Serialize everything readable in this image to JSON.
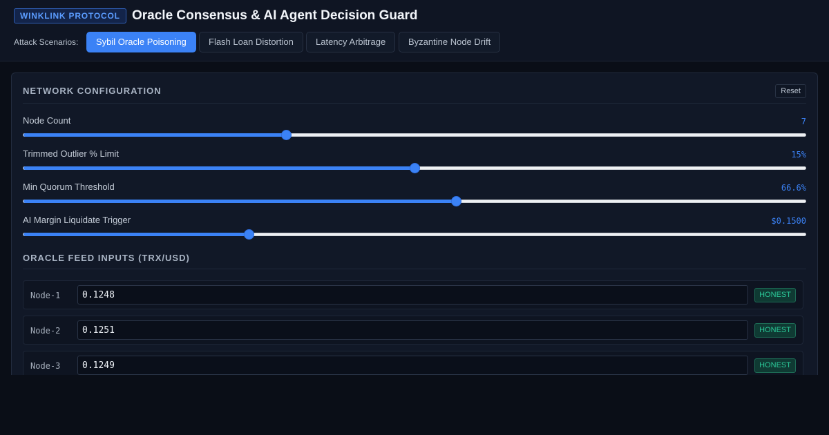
{
  "header": {
    "brand": "WINKLINK PROTOCOL",
    "title": "Oracle Consensus & AI Agent Decision Guard",
    "scenarios_label": "Attack Scenarios:",
    "scenarios": [
      {
        "label": "Sybil Oracle Poisoning",
        "active": true
      },
      {
        "label": "Flash Loan Distortion",
        "active": false
      },
      {
        "label": "Latency Arbitrage",
        "active": false
      },
      {
        "label": "Byzantine Node Drift",
        "active": false
      }
    ]
  },
  "network_config": {
    "title": "NETWORK CONFIGURATION",
    "reset_label": "Reset",
    "sliders": [
      {
        "label": "Node Count",
        "value": "7",
        "fill_fraction": 0.336
      },
      {
        "label": "Trimmed Outlier % Limit",
        "value": "15%",
        "fill_fraction": 0.5
      },
      {
        "label": "Min Quorum Threshold",
        "value": "66.6%",
        "fill_fraction": 0.553
      },
      {
        "label": "AI Margin Liquidate Trigger",
        "value": "$0.1500",
        "fill_fraction": 0.288
      }
    ]
  },
  "oracle_feed": {
    "title": "ORACLE FEED INPUTS (TRX/USD)",
    "nodes": [
      {
        "label": "Node-1",
        "value": "0.1248",
        "status": "HONEST"
      },
      {
        "label": "Node-2",
        "value": "0.1251",
        "status": "HONEST"
      },
      {
        "label": "Node-3",
        "value": "0.1249",
        "status": "HONEST"
      }
    ]
  },
  "colors": {
    "accent": "#3b82f6",
    "honest": "#2bc999",
    "background": "#0a0e17"
  }
}
